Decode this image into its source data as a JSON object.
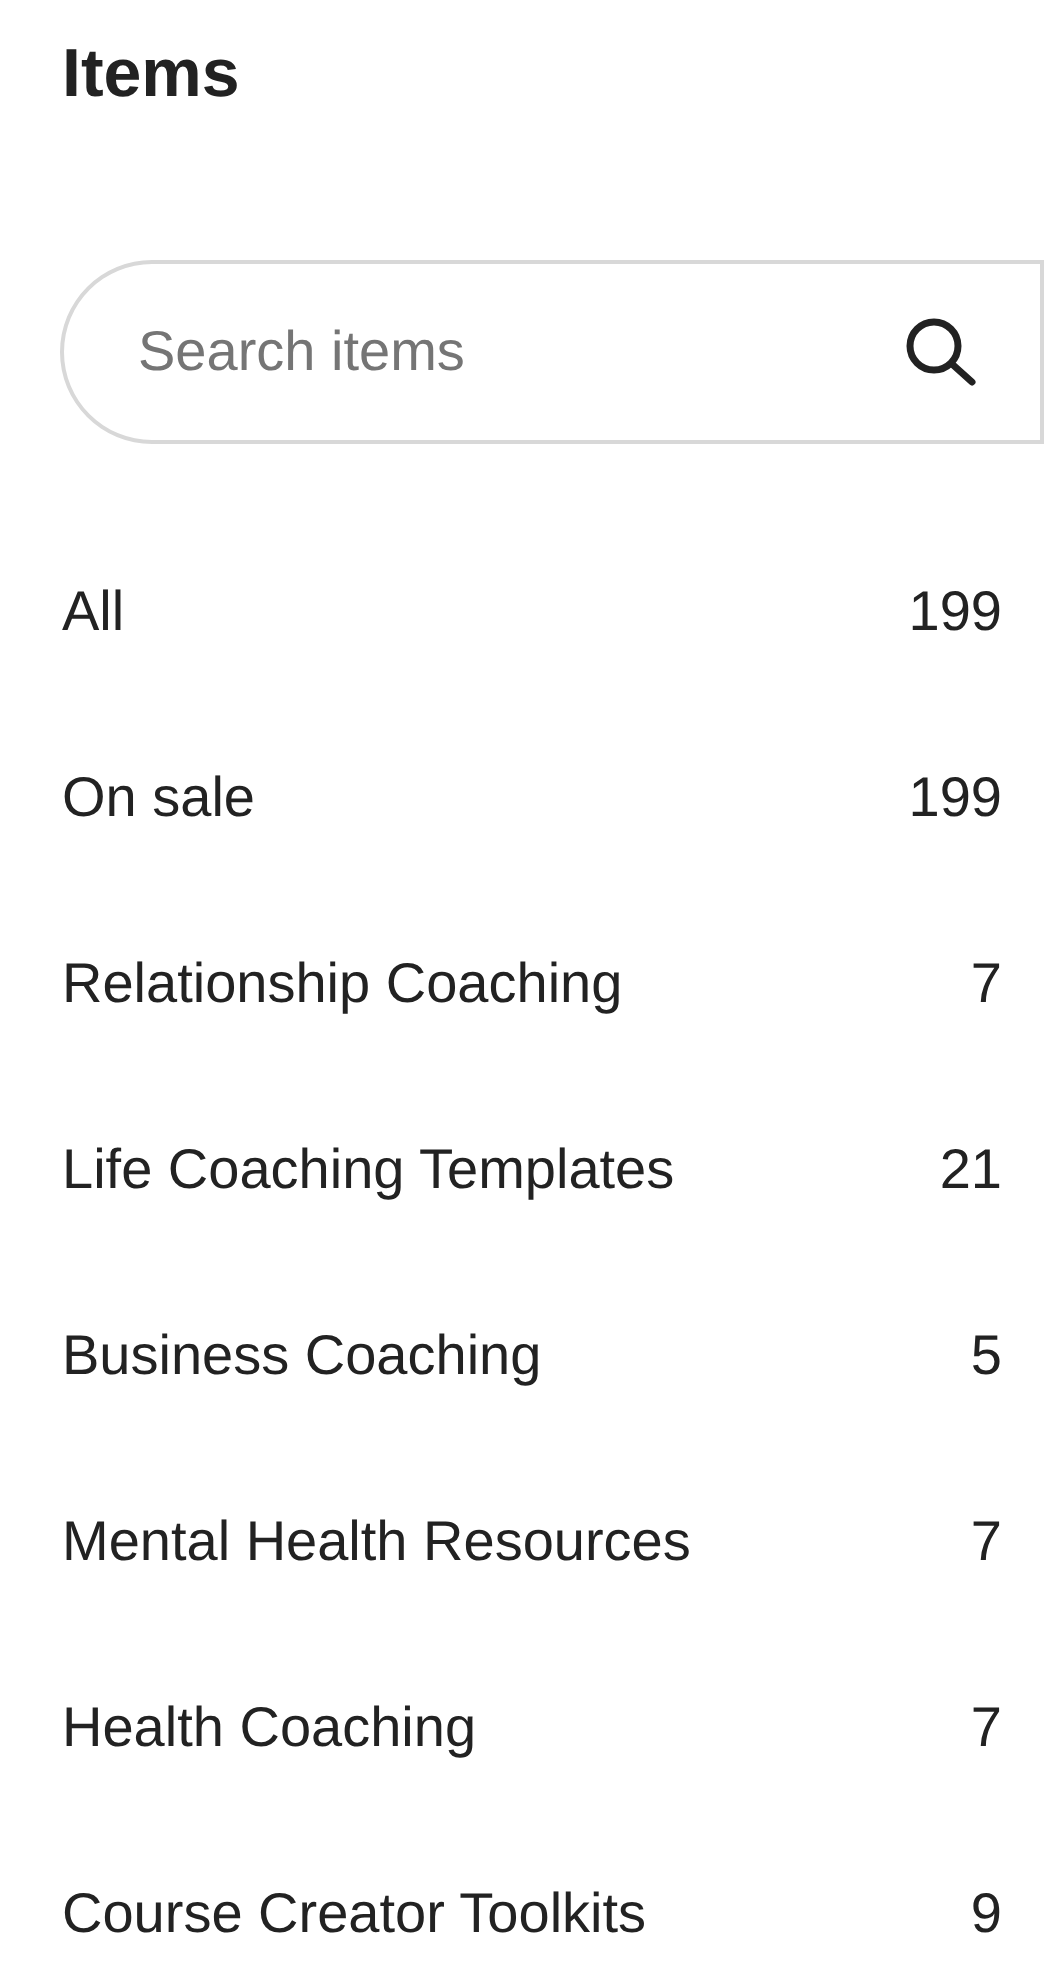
{
  "title": "Items",
  "search": {
    "placeholder": "Search items"
  },
  "categories": [
    {
      "label": "All",
      "count": "199"
    },
    {
      "label": "On sale",
      "count": "199"
    },
    {
      "label": "Relationship Coaching",
      "count": "7"
    },
    {
      "label": "Life Coaching Templates",
      "count": "21"
    },
    {
      "label": "Business Coaching",
      "count": "5"
    },
    {
      "label": "Mental Health Resources",
      "count": "7"
    },
    {
      "label": "Health Coaching",
      "count": "7"
    },
    {
      "label": "Course Creator Toolkits",
      "count": "9"
    }
  ]
}
